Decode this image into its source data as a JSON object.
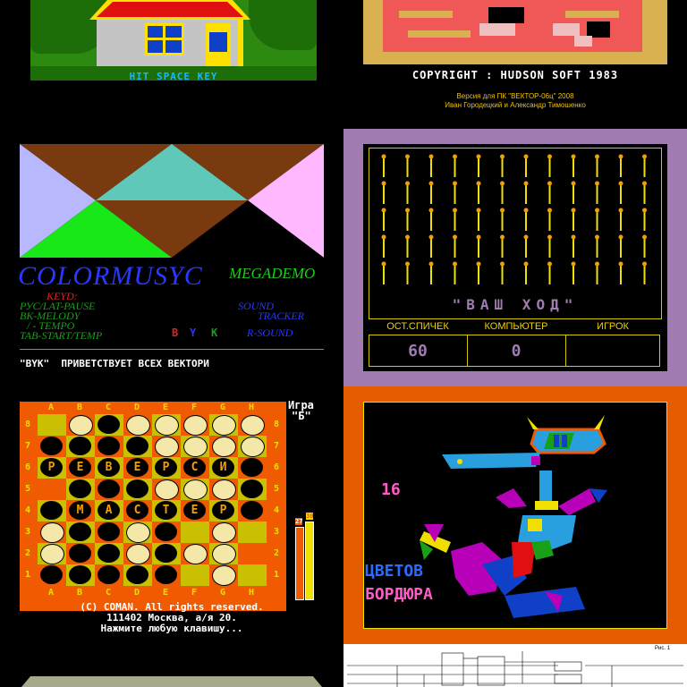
{
  "tiles": {
    "house": {
      "caption": "HIT SPACE KEY"
    },
    "hudson": {
      "copyright": "COPYRIGHT : HUDSON SOFT 1983",
      "version": "Версия для ПК \"ВЕКТОР-06ц\" 2008",
      "authors": "Иван Городецкий и Александр Тимошенко"
    },
    "colormusyc": {
      "title": "COLORMUSYC",
      "subtitle": "MEGADEMO",
      "keys_heading": "KEYD:",
      "key_lines": [
        "РУС/LAT-PAUSE",
        "ВК-MELODY",
        "/ - TEMPO",
        "TAB-START/TEMP"
      ],
      "byk_letters": [
        "B",
        "Y",
        "K"
      ],
      "sound_lines": [
        "SOUND",
        "TRACKER",
        "R-SOUND"
      ],
      "ticker": "\"BYK\"  ПРИВЕТСТВУЕТ ВСЕХ ВЕКТОРИ"
    },
    "matches": {
      "prompt": "\"ВАШ ХОД\"",
      "headers": [
        "ОСТ.СПИЧЕК",
        "КОМПЬЮТЕР",
        "ИГРОК"
      ],
      "values": [
        "60",
        "0",
        ""
      ]
    },
    "reversi": {
      "columns": [
        "A",
        "B",
        "C",
        "D",
        "E",
        "F",
        "G",
        "H"
      ],
      "rows": [
        "8",
        "7",
        "6",
        "5",
        "4",
        "3",
        "2",
        "1"
      ],
      "game_label": "Игра",
      "game_mode": "\"Б\"",
      "score_black": "27",
      "score_white": "30",
      "word_row6": [
        "Р",
        "Е",
        "В",
        "Е",
        "Р",
        "С",
        "И"
      ],
      "word_row4": [
        "М",
        "А",
        "С",
        "Т",
        "Е",
        "Р"
      ],
      "footer_lines": [
        "(C) COMAN. All rights reserved.",
        "111402 Москва, а/я 20.",
        "Нажмите любую клавишу..."
      ]
    },
    "border16": {
      "number": "16",
      "line1": "ЦВЕТОВ",
      "line2": "БОРДЮРА"
    },
    "schematic": {
      "label": "Рис. 1"
    }
  },
  "colors": {
    "reversi_orange": "#f05a00",
    "border_orange": "#e45c00",
    "mauve": "#a07cb0"
  }
}
